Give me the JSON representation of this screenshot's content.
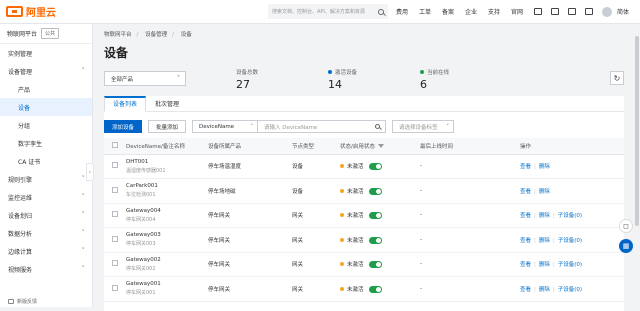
{
  "topbar": {
    "logo_text": "阿里云",
    "search_placeholder": "搜索文档、控制台、API、解决方案和资源",
    "nav": [
      "费用",
      "工单",
      "备案",
      "企业",
      "支持",
      "官网"
    ],
    "lang": "简体"
  },
  "sidebar": {
    "header": "物联网平台",
    "header_badge": "公共",
    "items": [
      {
        "label": "实例管理",
        "level": 0
      },
      {
        "label": "设备管理",
        "level": 0,
        "expanded": true
      },
      {
        "label": "产品",
        "level": 1
      },
      {
        "label": "设备",
        "level": 1,
        "active": true
      },
      {
        "label": "分组",
        "level": 1
      },
      {
        "label": "数字孪生",
        "level": 1
      },
      {
        "label": "CA 证书",
        "level": 1
      },
      {
        "label": "规则引擎",
        "level": 0
      },
      {
        "label": "监控运维",
        "level": 0
      },
      {
        "label": "设备划归",
        "level": 0
      },
      {
        "label": "数据分析",
        "level": 0
      },
      {
        "label": "边缘计算",
        "level": 0
      },
      {
        "label": "视频服务",
        "level": 0
      }
    ],
    "feedback": "新版反馈"
  },
  "breadcrumb": [
    "物联网平台",
    "设备管理",
    "设备"
  ],
  "page_title": "设备",
  "product_select": "全部产品",
  "stats": [
    {
      "label": "设备总数",
      "value": "27",
      "dot": "",
      "info": true
    },
    {
      "label": "激活设备",
      "value": "14",
      "dot": "#0070cc",
      "info": true
    },
    {
      "label": "当前在线",
      "value": "6",
      "dot": "#1e9e4a",
      "info": true
    }
  ],
  "tabs": [
    "设备列表",
    "批次管理"
  ],
  "toolbar": {
    "add_device": "添加设备",
    "batch_add": "批量添加",
    "filter_field": "DeviceName",
    "search_placeholder": "请输入 DeviceName",
    "tag_placeholder": "请选择设备标签"
  },
  "table": {
    "headers": [
      "DeviceName/备注名称",
      "设备所属产品",
      "节点类型",
      "状态/启用状态",
      "最后上线时间",
      "操作"
    ],
    "rows": [
      {
        "name": "DHT001",
        "remark": "温湿度传感器001",
        "product": "停车场温湿度",
        "node": "设备",
        "status": "未激活",
        "last": "-",
        "actions": [
          "查看",
          "删除"
        ]
      },
      {
        "name": "CarPark001",
        "remark": "车位检测001",
        "product": "停车场地磁",
        "node": "设备",
        "status": "未激活",
        "last": "-",
        "actions": [
          "查看",
          "删除"
        ]
      },
      {
        "name": "Gateway004",
        "remark": "停车网关004",
        "product": "停车网关",
        "node": "网关",
        "status": "未激活",
        "last": "-",
        "actions": [
          "查看",
          "删除",
          "子设备(0)"
        ]
      },
      {
        "name": "Gateway003",
        "remark": "停车网关003",
        "product": "停车网关",
        "node": "网关",
        "status": "未激活",
        "last": "-",
        "actions": [
          "查看",
          "删除",
          "子设备(0)"
        ]
      },
      {
        "name": "Gateway002",
        "remark": "停车网关002",
        "product": "停车网关",
        "node": "网关",
        "status": "未激活",
        "last": "-",
        "actions": [
          "查看",
          "删除",
          "子设备(0)"
        ]
      },
      {
        "name": "Gateway001",
        "remark": "停车网关001",
        "product": "停车网关",
        "node": "网关",
        "status": "未激活",
        "last": "-",
        "actions": [
          "查看",
          "删除",
          "子设备(0)"
        ]
      }
    ]
  },
  "colors": {
    "brand": "#ff6a00",
    "primary": "#0064c8",
    "success": "#1e9e4a",
    "warning": "#f5a623"
  }
}
